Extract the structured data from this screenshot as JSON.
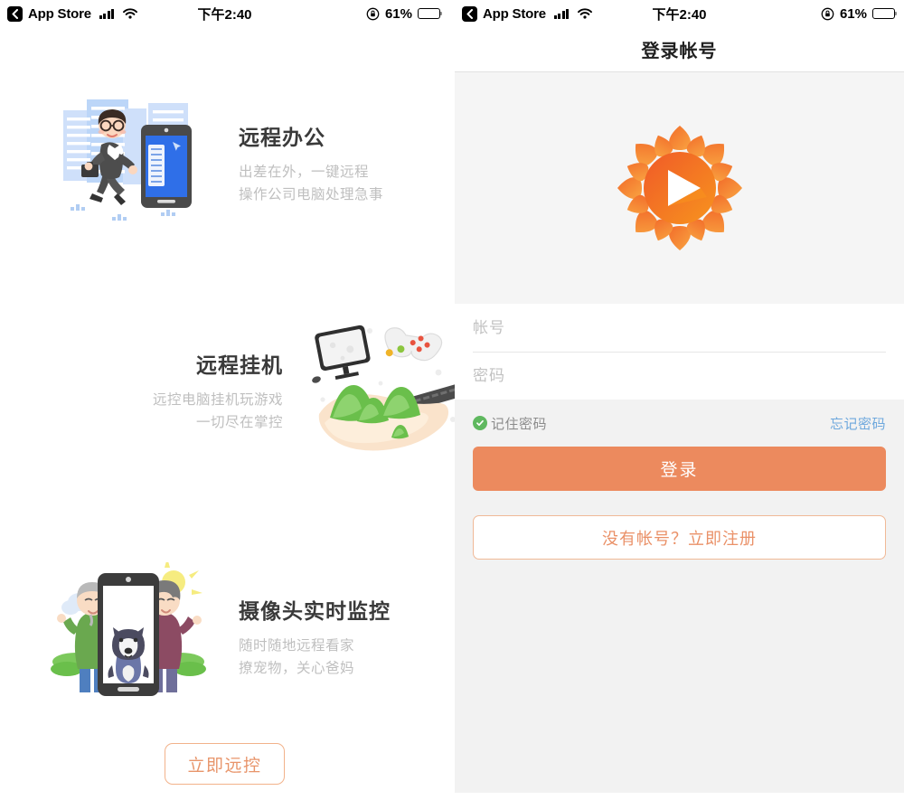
{
  "status_bar": {
    "back_label": "App Store",
    "time": "下午2:40",
    "battery_percent": "61%",
    "signal_icon": "signal-bars-icon",
    "wifi_icon": "wifi-icon",
    "rotation_lock_icon": "rotation-lock-icon",
    "battery_icon": "battery-icon",
    "battery_fill_ratio": 0.61
  },
  "left_screen": {
    "features": [
      {
        "title": "远程办公",
        "subtitle_line1": "出差在外，一键远程",
        "subtitle_line2": "操作公司电脑处理急事",
        "illustration": "businessman-running-with-phone-illustration"
      },
      {
        "title": "远程挂机",
        "subtitle_line1": "远控电脑挂机玩游戏",
        "subtitle_line2": "一切尽在掌控",
        "illustration": "hand-holding-mountains-with-devices-illustration"
      },
      {
        "title": "摄像头实时监控",
        "subtitle_line1": "随时随地远程看家",
        "subtitle_line2": "撩宠物，关心爸妈",
        "illustration": "elderly-couple-with-dog-on-phone-illustration"
      }
    ],
    "cta_button": "立即远控"
  },
  "right_screen": {
    "nav_title": "登录帐号",
    "logo": "sunlogin-sunflower-logo",
    "account_placeholder": "帐号",
    "account_value": "",
    "password_placeholder": "密码",
    "password_value": "",
    "remember_label": "记住密码",
    "remember_checked": true,
    "forgot_label": "忘记密码",
    "login_button": "登录",
    "register_button": "没有帐号？立即注册"
  },
  "colors": {
    "accent_orange": "#ec8a5e",
    "accent_orange_light": "#f0b997",
    "link_blue": "#6ea8dd",
    "check_green": "#5fb85f",
    "panel_gray": "#f2f2f2",
    "logo_area_gray": "#f5f5f5",
    "title_gray": "#3a3a3a",
    "subtitle_gray": "#bfbfbf"
  }
}
